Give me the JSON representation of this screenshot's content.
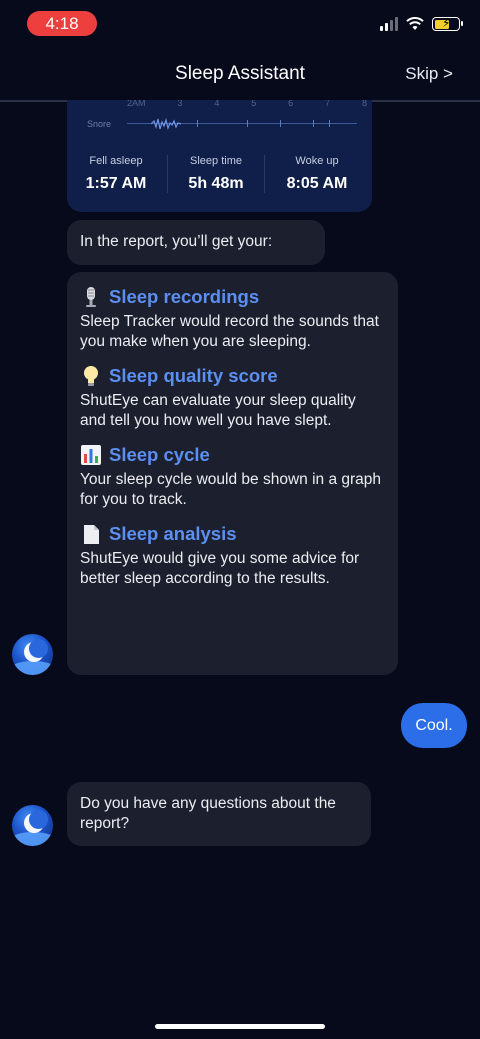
{
  "status_bar": {
    "time": "4:18"
  },
  "header": {
    "title": "Sleep Assistant",
    "skip_label": "Skip >"
  },
  "graph_card": {
    "axis_labels": [
      "2AM",
      "3",
      "4",
      "5",
      "6",
      "7",
      "8"
    ],
    "snore_label": "Snore",
    "stats": [
      {
        "label": "Fell asleep",
        "value": "1:57 AM"
      },
      {
        "label": "Sleep time",
        "value": "5h 48m"
      },
      {
        "label": "Woke up",
        "value": "8:05 AM"
      }
    ]
  },
  "chat": {
    "intro": "In the report, you’ll get your:",
    "features": [
      {
        "icon": "microphone-icon",
        "title": "Sleep recordings",
        "desc": "Sleep Tracker would record the sounds that you make when you are sleeping."
      },
      {
        "icon": "lightbulb-icon",
        "title": "Sleep quality score",
        "desc": "ShutEye can evaluate your sleep quality and tell you how well you have slept."
      },
      {
        "icon": "bar-chart-icon",
        "title": "Sleep cycle",
        "desc": "Your sleep cycle would be shown in a graph for you to track."
      },
      {
        "icon": "document-icon",
        "title": "Sleep analysis",
        "desc": "ShutEye would give you some advice for better sleep according to the results."
      }
    ],
    "user_reply": "Cool.",
    "question": "Do you have any questions about the report?"
  },
  "colors": {
    "accent": "#5b8ff2",
    "user_bubble": "#2b6ee8",
    "status_time_bg": "#ee3f3f"
  }
}
